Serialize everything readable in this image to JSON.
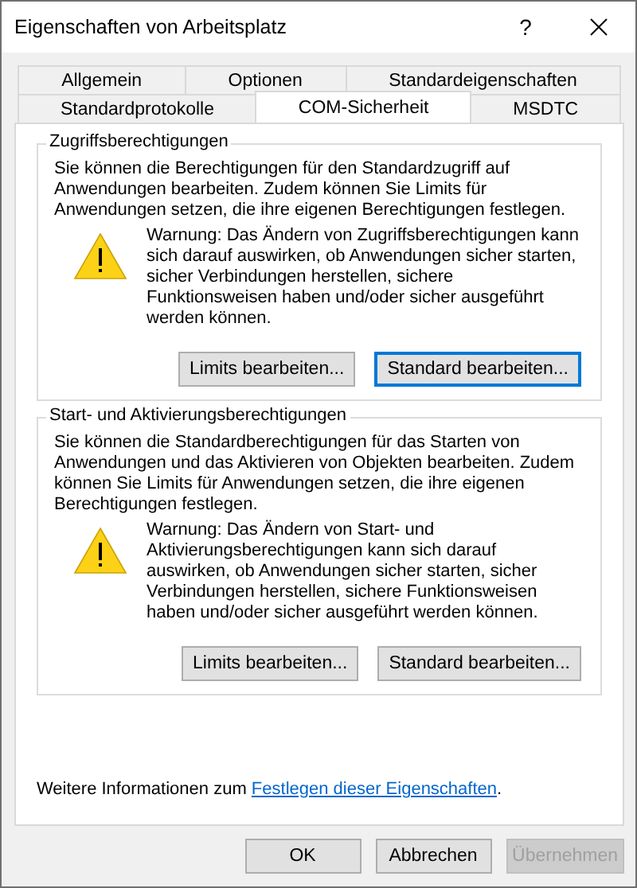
{
  "window": {
    "title": "Eigenschaften von Arbeitsplatz",
    "help": "?"
  },
  "tab_rows": [
    [
      {
        "label": "Allgemein",
        "selected": false
      },
      {
        "label": "Optionen",
        "selected": false
      },
      {
        "label": "Standardeigenschaften",
        "selected": false
      }
    ],
    [
      {
        "label": "Standardprotokolle",
        "selected": false
      },
      {
        "label": "COM-Sicherheit",
        "selected": true
      },
      {
        "label": "MSDTC",
        "selected": false
      }
    ]
  ],
  "groups": [
    {
      "title": "Zugriffsberechtigungen",
      "description": "Sie können die Berechtigungen für den Standardzugriff auf Anwendungen bearbeiten. Zudem können Sie Limits für Anwendungen setzen, die ihre eigenen Berechtigungen festlegen.",
      "warning": "Warnung: Das Ändern von Zugriffsberechtigungen kann sich darauf auswirken, ob Anwendungen sicher starten, sicher Verbindungen herstellen, sichere Funktionsweisen haben und/oder sicher ausgeführt werden können.",
      "buttons": [
        {
          "label": "Limits bearbeiten...",
          "default": false
        },
        {
          "label": "Standard bearbeiten...",
          "default": true
        }
      ]
    },
    {
      "title": "Start- und Aktivierungsberechtigungen",
      "description": "Sie können die Standardberechtigungen für das Starten von Anwendungen und das Aktivieren von Objekten bearbeiten. Zudem können Sie Limits für Anwendungen setzen, die ihre eigenen Berechtigungen festlegen.",
      "warning": "Warnung: Das Ändern von Start- und Aktivierungsberechtigungen kann sich darauf auswirken, ob Anwendungen sicher starten, sicher Verbindungen herstellen, sichere Funktionsweisen haben und/oder sicher ausgeführt werden können.",
      "buttons": [
        {
          "label": "Limits bearbeiten...",
          "default": false
        },
        {
          "label": "Standard bearbeiten...",
          "default": false
        }
      ]
    }
  ],
  "info": {
    "text": "Weitere Informationen zum",
    "link": "Festlegen dieser Eigenschaften",
    "suffix": "."
  },
  "buttons": [
    {
      "label": "OK",
      "disabled": false
    },
    {
      "label": "Abbrechen",
      "disabled": false
    },
    {
      "label": "Übernehmen",
      "disabled": true
    }
  ]
}
